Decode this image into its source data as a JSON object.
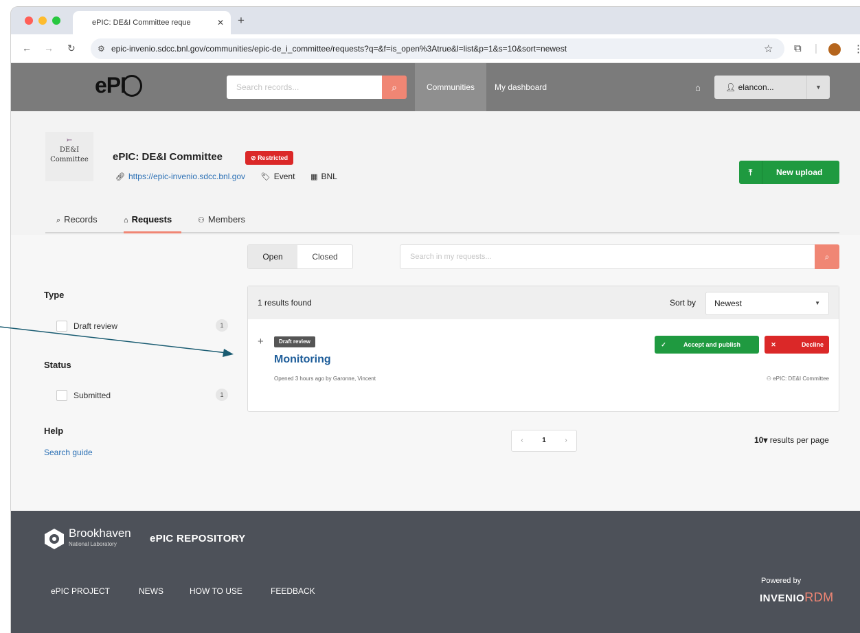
{
  "browser": {
    "tab_title": "ePIC: DE&I Committee reque",
    "tab_close": "✕",
    "new_tab": "+",
    "url": "epic-invenio.sdcc.bnl.gov/communities/epic-de_i_committee/requests?q=&f=is_open%3Atrue&l=list&p=1&s=10&sort=newest",
    "icons": [
      "back-icon",
      "forward-icon",
      "reload-icon",
      "site-settings-icon",
      "star-icon",
      "extensions-icon",
      "profile-avatar",
      "menu-icon"
    ],
    "traffic_colors": [
      "#ff5f57",
      "#febc2e",
      "#28c840"
    ]
  },
  "header": {
    "logo_text": "ePI",
    "search_placeholder": "Search records...",
    "nav_communities": "Communities",
    "nav_dashboard": "My dashboard",
    "user_label": "elancon...",
    "colors": {
      "header_bg": "#7b7b7b",
      "accent": "#f08674"
    }
  },
  "community": {
    "logo_line1": "DE&I",
    "logo_line2": "Committee",
    "title": "ePIC: DE&I Committee",
    "restricted_badge": "Restricted",
    "website": "https://epic-invenio.sdcc.bnl.gov",
    "type": "Event",
    "organization": "BNL",
    "new_upload": "New upload",
    "tabs": [
      {
        "label": "Records",
        "icon": "search-icon"
      },
      {
        "label": "Requests",
        "icon": "inbox-icon"
      },
      {
        "label": "Members",
        "icon": "users-icon"
      }
    ]
  },
  "requests": {
    "toggle_open": "Open",
    "toggle_closed": "Closed",
    "search_placeholder": "Search in my requests...",
    "results_found": "1 results found",
    "sort_by_label": "Sort by",
    "sort_value": "Newest",
    "items": [
      {
        "label": "Draft review",
        "title": "Monitoring",
        "meta": "Opened 3 hours ago by Garonne, Vincent",
        "community": "ePIC: DE&I Committee",
        "accept_label": "Accept and publish",
        "decline_label": "Decline"
      }
    ],
    "pagination": {
      "prev": "‹",
      "current": "1",
      "next": "›"
    },
    "per_page_value": "10",
    "per_page_label": "results per page"
  },
  "facets": {
    "type_title": "Type",
    "type_items": [
      {
        "label": "Draft review",
        "count": "1"
      }
    ],
    "status_title": "Status",
    "status_items": [
      {
        "label": "Submitted",
        "count": "1"
      }
    ],
    "help_title": "Help",
    "search_guide": "Search guide"
  },
  "footer": {
    "org_name": "Brookhaven",
    "org_sub": "National Laboratory",
    "repo_name": "ePIC REPOSITORY",
    "nav": [
      "ePIC PROJECT",
      "NEWS",
      "HOW TO USE",
      "FEEDBACK"
    ],
    "powered_by": "Powered by",
    "invenio_left": "INVENIO",
    "invenio_rdm": "RDM"
  }
}
